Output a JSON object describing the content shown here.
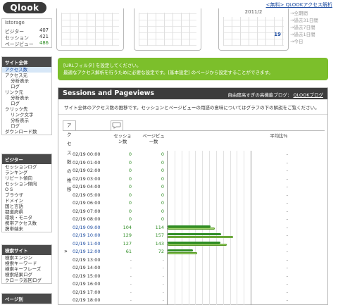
{
  "app": {
    "logo": "Qlook",
    "top_link": "<無料> QLOOKアクセス解析"
  },
  "calendar": {
    "month_title": "2011/2",
    "highlight_day": "19"
  },
  "quick_links": [
    "→全期間",
    "→過去31日間",
    "→過去7日間",
    "→過去1日間",
    "→今日"
  ],
  "stats": {
    "title": "Istorage",
    "rows": [
      {
        "label": "ビジター",
        "value": "407"
      },
      {
        "label": "セッション",
        "value": "421"
      },
      {
        "label": "ページビュー",
        "value": "486"
      }
    ]
  },
  "menus": [
    {
      "header": "サイト全体",
      "items": [
        {
          "label": "アクセス数",
          "indent": false,
          "active": true
        },
        {
          "label": "アクセス元",
          "indent": false,
          "active": false
        },
        {
          "label": "分析表示",
          "indent": true,
          "active": false
        },
        {
          "label": "ログ",
          "indent": true,
          "active": false
        },
        {
          "label": "リンク元",
          "indent": false,
          "active": false
        },
        {
          "label": "分析表示",
          "indent": true,
          "active": false
        },
        {
          "label": "ログ",
          "indent": true,
          "active": false
        },
        {
          "label": "クリック先",
          "indent": false,
          "active": false
        },
        {
          "label": "リンク文字",
          "indent": true,
          "active": false
        },
        {
          "label": "分析表示",
          "indent": true,
          "active": false
        },
        {
          "label": "ログ",
          "indent": true,
          "active": false
        },
        {
          "label": "ダウンロード数",
          "indent": false,
          "active": false
        }
      ]
    },
    {
      "header": "ビジター",
      "items": [
        {
          "label": "セッションログ",
          "indent": false,
          "active": false
        },
        {
          "label": "ランキング",
          "indent": false,
          "active": false
        },
        {
          "label": "リピート傾向",
          "indent": false,
          "active": false
        },
        {
          "label": "セッション傾向",
          "indent": false,
          "active": false
        },
        {
          "label": "O S",
          "indent": false,
          "active": false
        },
        {
          "label": "ブラウザ",
          "indent": false,
          "active": false
        },
        {
          "label": "ドメイン",
          "indent": false,
          "active": false
        },
        {
          "label": "国と言語",
          "indent": false,
          "active": false
        },
        {
          "label": "都道府県",
          "indent": false,
          "active": false
        },
        {
          "label": "環境・モニタ",
          "indent": false,
          "active": false
        },
        {
          "label": "携帯アクセス数",
          "indent": false,
          "active": false
        },
        {
          "label": "携帯端末",
          "indent": false,
          "active": false
        }
      ]
    },
    {
      "header": "検索サイト",
      "items": [
        {
          "label": "検索エンジン",
          "indent": false,
          "active": false
        },
        {
          "label": "検索キーワード",
          "indent": false,
          "active": false
        },
        {
          "label": "検索キーフレーズ",
          "indent": false,
          "active": false
        },
        {
          "label": "検索結果ログ",
          "indent": false,
          "active": false
        },
        {
          "label": "クローラ巡回ログ",
          "indent": false,
          "active": false
        }
      ]
    },
    {
      "header": "ページ別",
      "items": []
    }
  ],
  "notice": {
    "line1": "[URLフィルタ] を設定してください。",
    "line2": "最適なアクセス解析を行うために必要な設定です。[基本設定] のページから設定することができます。"
  },
  "panel": {
    "title": "Sessions and Pageviews",
    "right_prefix": "自由度高すぎの高機能ブログ：",
    "right_link": "QLOOKブログ",
    "description": "サイト全体のアクセス数の推移です。セッションとページビューの用語の意味についてはグラフの下の解説をご覧ください。",
    "tab_label": "アクセス数の推移",
    "col_sessions": "セッション数",
    "col_pageviews": "ページビュー数",
    "col_ratio": "平均比％",
    "row_marker": "»"
  },
  "chart_data": {
    "type": "bar",
    "categories": [
      "02/19 00:00",
      "02/19 01:00",
      "02/19 02:00",
      "02/19 03:00",
      "02/19 04:00",
      "02/19 05:00",
      "02/19 06:00",
      "02/19 07:00",
      "02/19 08:00",
      "02/19 09:00",
      "02/19 10:00",
      "02/19 11:00",
      "02/19 12:00",
      "02/19 13:00",
      "02/19 14:00",
      "02/19 15:00",
      "02/19 16:00",
      "02/19 17:00",
      "02/19 18:00"
    ],
    "series": [
      {
        "name": "セッション数",
        "values": [
          0,
          0,
          0,
          0,
          0,
          0,
          0,
          0,
          0,
          104,
          129,
          127,
          61,
          null,
          null,
          null,
          null,
          null,
          null
        ]
      },
      {
        "name": "ページビュー数",
        "values": [
          0,
          0,
          0,
          0,
          0,
          0,
          0,
          0,
          0,
          114,
          157,
          143,
          72,
          null,
          null,
          null,
          null,
          null,
          null
        ]
      }
    ],
    "ratio": [
      "-",
      "-",
      "-",
      "-",
      "-",
      "-",
      "-",
      "-",
      "-",
      "-",
      "-",
      "-",
      "-",
      "-",
      "-",
      "-",
      "-",
      "-",
      "-"
    ],
    "current_index": 12,
    "xlim": [
      0,
      200
    ],
    "grid": true
  }
}
